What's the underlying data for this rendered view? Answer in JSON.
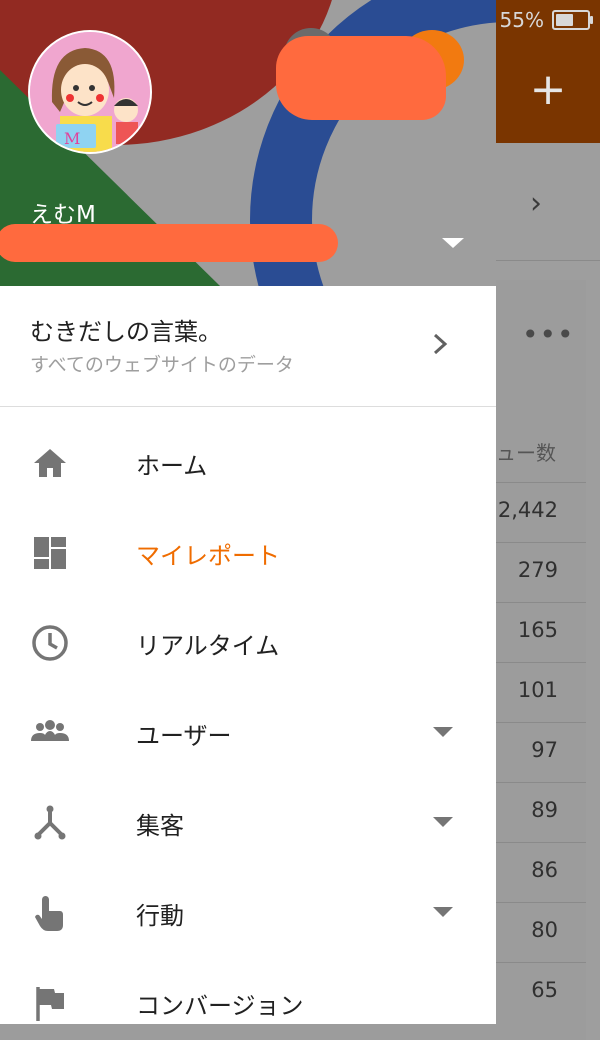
{
  "status_bar": {
    "battery": "55%",
    "battery_level": 0.55
  },
  "background": {
    "column_header": "ュー数",
    "values": [
      "2,442",
      "279",
      "165",
      "101",
      "97",
      "89",
      "86",
      "80",
      "65"
    ]
  },
  "drawer": {
    "account": {
      "name": "えむM"
    },
    "property": {
      "name": "むきだしの言葉。",
      "view": "すべてのウェブサイトのデータ"
    },
    "menu": [
      {
        "label": "ホーム",
        "icon": "home-icon",
        "active": false,
        "expandable": false
      },
      {
        "label": "マイレポート",
        "icon": "dashboard-icon",
        "active": true,
        "expandable": false
      },
      {
        "label": "リアルタイム",
        "icon": "clock-icon",
        "active": false,
        "expandable": false
      },
      {
        "label": "ユーザー",
        "icon": "people-icon",
        "active": false,
        "expandable": true
      },
      {
        "label": "集客",
        "icon": "merge-icon",
        "active": false,
        "expandable": true
      },
      {
        "label": "行動",
        "icon": "touch-icon",
        "active": false,
        "expandable": true
      },
      {
        "label": "コンバージョン",
        "icon": "flag-icon",
        "active": false,
        "expandable": false
      }
    ]
  },
  "colors": {
    "accent": "#ef6c00",
    "header_red": "#922a22",
    "header_blue": "#2a4c93",
    "header_green": "#2b6a32",
    "icon_gray": "#757575"
  }
}
